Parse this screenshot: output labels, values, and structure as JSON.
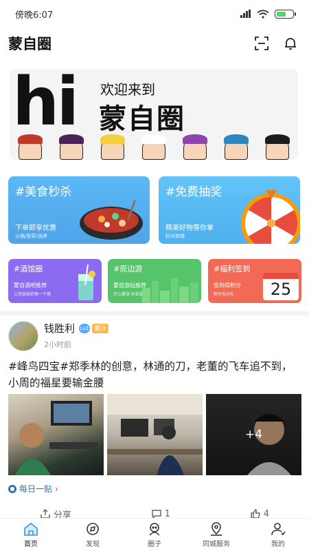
{
  "status": {
    "time": "傍晚6:07",
    "battery_level": 0.6
  },
  "header": {
    "title": "蒙自圈"
  },
  "banner": {
    "hi": "hi",
    "welcome": "欢迎来到",
    "brand": "蒙自圈"
  },
  "promos": [
    {
      "title": "#美食秒杀",
      "sub": "下单即享优惠",
      "sub2": "火锅/冒菜/烧烤",
      "color_top": "#5bb8f5",
      "color_bottom": "#4fa4ea"
    },
    {
      "title": "#免费抽奖",
      "sub": "精美好物等你拿",
      "sub2": "好对商城",
      "color_top": "#62c4f7",
      "color_bottom": "#4fb0ef"
    }
  ],
  "minis": [
    {
      "title": "#酒馆圈",
      "sub": "蒙自酒吧推荐",
      "sub2": "让你放松的每一个夜",
      "color": "#8b6cf0"
    },
    {
      "title": "#周边游",
      "sub": "蒙自游玩推荐",
      "sub2": "开心蒙自 好去处",
      "color": "#55c46b"
    },
    {
      "title": "#福利签到",
      "sub": "签到得积分",
      "sub2": "积分兑好礼",
      "color": "#f26a55",
      "calendar_day": "25"
    }
  ],
  "post": {
    "author": "钱胜利",
    "level_badge": "Lv2",
    "tag_badge": "果汁",
    "time": "2小时前",
    "text": "#峰鸟四宝#郑季林的创意，林通的刀，老董的飞车追不到，小周的福星要输金腰",
    "more_count": "+4",
    "daily_label": "每日一贴",
    "share_label": "分享",
    "comment_count": "1",
    "like_count": "4"
  },
  "tabs": [
    {
      "label": "首页",
      "icon": "home-icon"
    },
    {
      "label": "发现",
      "icon": "discover-icon"
    },
    {
      "label": "圈子",
      "icon": "circle-icon"
    },
    {
      "label": "同城服务",
      "icon": "location-icon"
    },
    {
      "label": "我的",
      "icon": "profile-icon"
    }
  ]
}
